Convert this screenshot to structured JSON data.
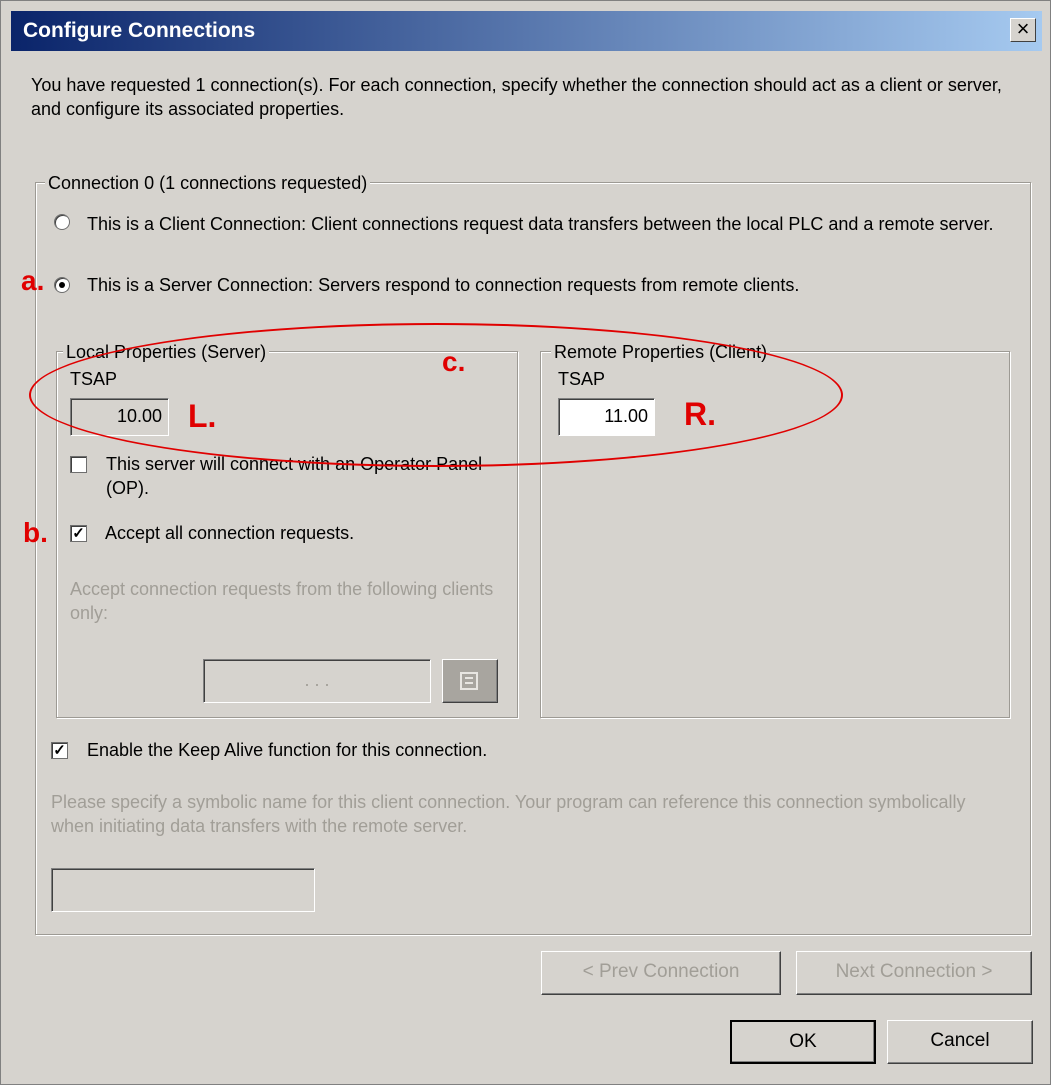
{
  "title": "Configure Connections",
  "close_glyph": "×",
  "intro": "You have requested 1 connection(s).  For each connection, specify whether the connection should act as a client or server, and configure its associated properties.",
  "connection_group": {
    "legend": "Connection 0 (1 connections requested)",
    "client_option": "This is a Client Connection: Client connections request data transfers between the local PLC and a remote server.",
    "server_option": "This is a Server Connection: Servers respond to connection requests from remote clients.",
    "selected": "server"
  },
  "local": {
    "legend": "Local Properties (Server)",
    "tsap_label": "TSAP",
    "tsap_value": "10.00",
    "op_panel_label": "This server will connect with an Operator Panel (OP).",
    "op_panel_checked": false,
    "accept_all_label": "Accept all connection requests.",
    "accept_all_checked": true,
    "accept_clients_label": "Accept connection requests from the following clients only:",
    "ip_placeholder": ".   .   .",
    "ip_button_icon": "address-book-icon"
  },
  "remote": {
    "legend": "Remote Properties (Client)",
    "tsap_label": "TSAP",
    "tsap_value": "11.00"
  },
  "keep_alive_label": "Enable the Keep Alive function for this connection.",
  "keep_alive_checked": true,
  "symbolic_hint": "Please specify a symbolic name for this client connection.  Your program can reference this connection symbolically when initiating data transfers with the remote server.",
  "buttons": {
    "prev": "< Prev Connection",
    "next": "Next Connection >",
    "ok": "OK",
    "cancel": "Cancel"
  },
  "annotations": {
    "a": "a.",
    "b": "b.",
    "c": "c.",
    "l": "L.",
    "r": "R."
  },
  "colors": {
    "title_bar": "#0a246a",
    "dialog_bg": "#d6d3ce",
    "annotation": "#e00000"
  }
}
